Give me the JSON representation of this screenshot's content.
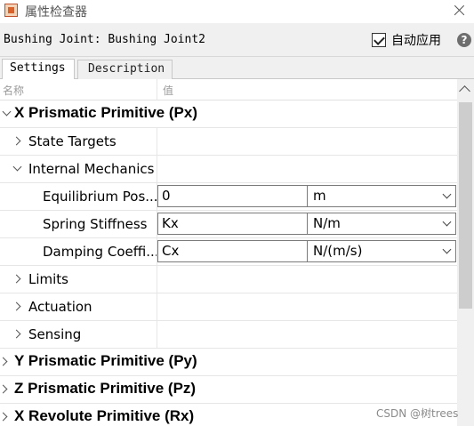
{
  "window": {
    "title": "属性检查器"
  },
  "header": {
    "block_name": "Bushing Joint: Bushing Joint2",
    "auto_apply_label": "自动应用",
    "auto_apply_checked": true,
    "help_glyph": "?"
  },
  "tabs": [
    {
      "label": "Settings",
      "active": true
    },
    {
      "label": "Description",
      "active": false
    }
  ],
  "columns": {
    "name": "名称",
    "value": "值"
  },
  "tree": {
    "x_prismatic": "X Prismatic Primitive (Px)",
    "state_targets": "State Targets",
    "internal_mechanics": "Internal Mechanics",
    "equilibrium": {
      "label": "Equilibrium Pos...",
      "value": "0",
      "unit": "m"
    },
    "spring": {
      "label": "Spring Stiffness",
      "value": "Kx",
      "unit": "N/m"
    },
    "damping": {
      "label": "Damping Coeffi...",
      "value": "Cx",
      "unit": "N/(m/s)"
    },
    "limits": "Limits",
    "actuation": "Actuation",
    "sensing": "Sensing",
    "y_prismatic": "Y Prismatic Primitive (Py)",
    "z_prismatic": "Z Prismatic Primitive (Pz)",
    "x_revolute": "X Revolute Primitive (Rx)"
  },
  "watermark": "CSDN @树trees"
}
